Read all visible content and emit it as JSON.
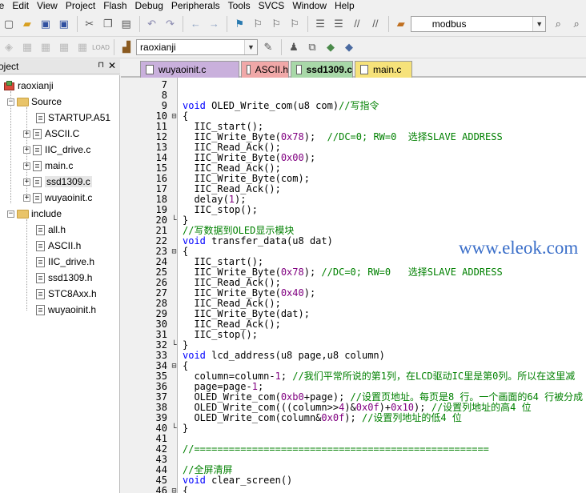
{
  "menu": [
    "le",
    "Edit",
    "View",
    "Project",
    "Flash",
    "Debug",
    "Peripherals",
    "Tools",
    "SVCS",
    "Window",
    "Help"
  ],
  "toolbar": {
    "target_combo": "modbus",
    "project_combo": "raoxianji"
  },
  "project_panel": {
    "title": "oject",
    "root": "raoxianji",
    "groups": [
      {
        "name": "Source",
        "files": [
          "STARTUP.A51",
          "ASCII.C",
          "IIC_drive.c",
          "main.c",
          "ssd1309.c",
          "wuyaoinit.c"
        ]
      },
      {
        "name": "include",
        "files": [
          "all.h",
          "ASCII.h",
          "IIC_drive.h",
          "ssd1309.h",
          "STC8Axx.h",
          "wuyaoinit.h"
        ]
      }
    ]
  },
  "tabs": [
    "wuyaoinit.c",
    "ASCII.h",
    "ssd1309.c",
    "main.c"
  ],
  "watermark": "www.eleok.com",
  "code": [
    {
      "n": "7",
      "t": ""
    },
    {
      "n": "8",
      "t": ""
    },
    {
      "n": "9",
      "t": "void OLED_Write_com(u8 com)//写指令"
    },
    {
      "n": "10",
      "t": "{"
    },
    {
      "n": "11",
      "t": "  IIC_start();"
    },
    {
      "n": "12",
      "t": "  IIC_Write_Byte(0x78);  //DC=0; RW=0  选择SLAVE ADDRESS"
    },
    {
      "n": "13",
      "t": "  IIC_Read_Ack();"
    },
    {
      "n": "14",
      "t": "  IIC_Write_Byte(0x00);"
    },
    {
      "n": "15",
      "t": "  IIC_Read_Ack();"
    },
    {
      "n": "16",
      "t": "  IIC_Write_Byte(com);"
    },
    {
      "n": "17",
      "t": "  IIC_Read_Ack();"
    },
    {
      "n": "18",
      "t": "  delay(1);"
    },
    {
      "n": "19",
      "t": "  IIC_stop();"
    },
    {
      "n": "20",
      "t": "}"
    },
    {
      "n": "21",
      "t": "//写数据到OLED显示模块"
    },
    {
      "n": "22",
      "t": "void transfer_data(u8 dat)"
    },
    {
      "n": "23",
      "t": "{"
    },
    {
      "n": "24",
      "t": "  IIC_start();"
    },
    {
      "n": "25",
      "t": "  IIC_Write_Byte(0x78); //DC=0; RW=0   选择SLAVE ADDRESS"
    },
    {
      "n": "26",
      "t": "  IIC_Read_Ack();"
    },
    {
      "n": "27",
      "t": "  IIC_Write_Byte(0x40);"
    },
    {
      "n": "28",
      "t": "  IIC_Read_Ack();"
    },
    {
      "n": "29",
      "t": "  IIC_Write_Byte(dat);"
    },
    {
      "n": "30",
      "t": "  IIC_Read_Ack();"
    },
    {
      "n": "31",
      "t": "  IIC_stop();"
    },
    {
      "n": "32",
      "t": "}"
    },
    {
      "n": "33",
      "t": "void lcd_address(u8 page,u8 column)"
    },
    {
      "n": "34",
      "t": "{"
    },
    {
      "n": "35",
      "t": "  column=column-1; //我们平常所说的第1列，在LCD驱动IC里是第0列。所以在这里减"
    },
    {
      "n": "36",
      "t": "  page=page-1;"
    },
    {
      "n": "37",
      "t": "  OLED_Write_com(0xb0+page); //设置页地址。每页是8 行。一个画面的64 行被分成"
    },
    {
      "n": "38",
      "t": "  OLED_Write_com(((column>>4)&0x0f)+0x10); //设置列地址的高4 位"
    },
    {
      "n": "39",
      "t": "  OLED_Write_com(column&0x0f); //设置列地址的低4 位"
    },
    {
      "n": "40",
      "t": "}"
    },
    {
      "n": "41",
      "t": ""
    },
    {
      "n": "42",
      "t": "//==================================================="
    },
    {
      "n": "43",
      "t": ""
    },
    {
      "n": "44",
      "t": "//全屏清屏"
    },
    {
      "n": "45",
      "t": "void clear_screen()"
    },
    {
      "n": "46",
      "t": "{"
    }
  ]
}
